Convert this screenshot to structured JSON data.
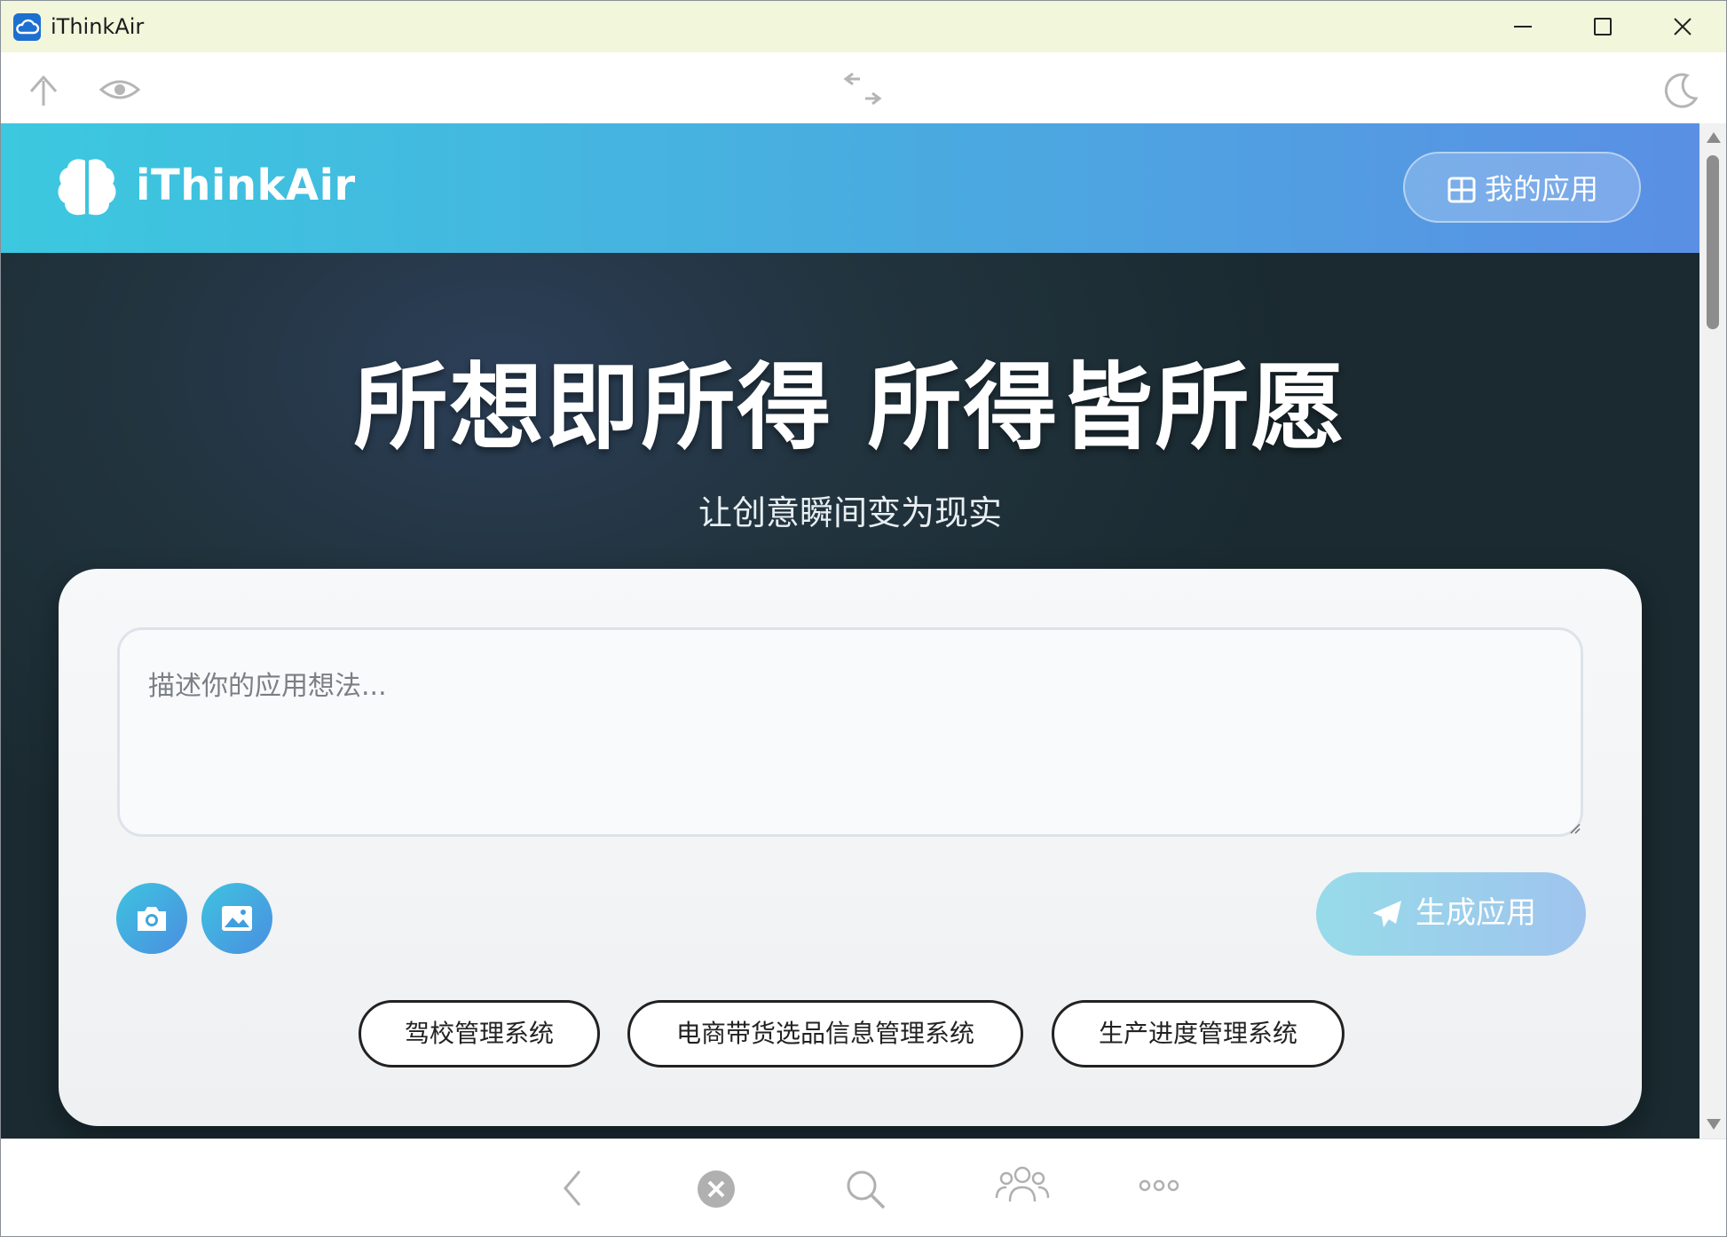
{
  "window": {
    "title": "iThinkAir",
    "app_icon": "cloud-icon",
    "controls": [
      "minimize-icon",
      "maximize-icon",
      "close-icon"
    ]
  },
  "toolbar": {
    "left_icons": [
      "upload-arrow-icon",
      "eye-icon"
    ],
    "center_icon": "swap-arrows-icon",
    "right_icon": "moon-icon"
  },
  "header": {
    "brand_icon": "brain-icon",
    "brand_name": "iThinkAir",
    "my_apps_icon": "grid-icon",
    "my_apps_label": "我的应用"
  },
  "hero": {
    "title": "所想即所得 所得皆所愿",
    "subtitle": "让创意瞬间变为现实"
  },
  "composer": {
    "placeholder": "描述你的应用想法...",
    "value": "",
    "camera_icon": "camera-icon",
    "image_icon": "image-icon",
    "generate_icon": "send-icon",
    "generate_label": "生成应用"
  },
  "suggestions": [
    "驾校管理系统",
    "电商带货选品信息管理系统",
    "生产进度管理系统"
  ],
  "bottom_nav": [
    "back-chevron-icon",
    "close-circle-icon",
    "search-icon",
    "people-icon",
    "more-dots-icon"
  ],
  "colors": {
    "titlebar_bg": "#f2f7dc",
    "header_gradient_start": "#3cc8df",
    "header_gradient_end": "#5a8fe4",
    "hero_bg": "#1e2a33",
    "accent": "#4aaae0"
  }
}
